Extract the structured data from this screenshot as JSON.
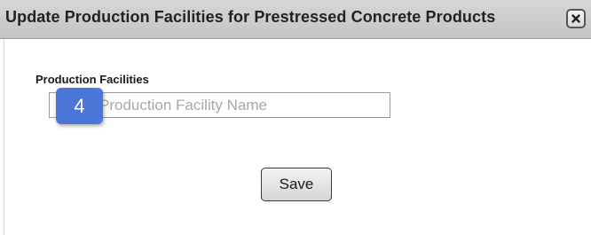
{
  "dialog": {
    "title": "Update Production Facilities for Prestressed Concrete Products",
    "close_icon": "close-icon"
  },
  "form": {
    "field_label": "Production Facilities",
    "field_value": "",
    "field_placeholder": "Production Facility Name",
    "save_label": "Save"
  },
  "overlay": {
    "step_number": "4",
    "badge_color": "#4a77d8"
  }
}
